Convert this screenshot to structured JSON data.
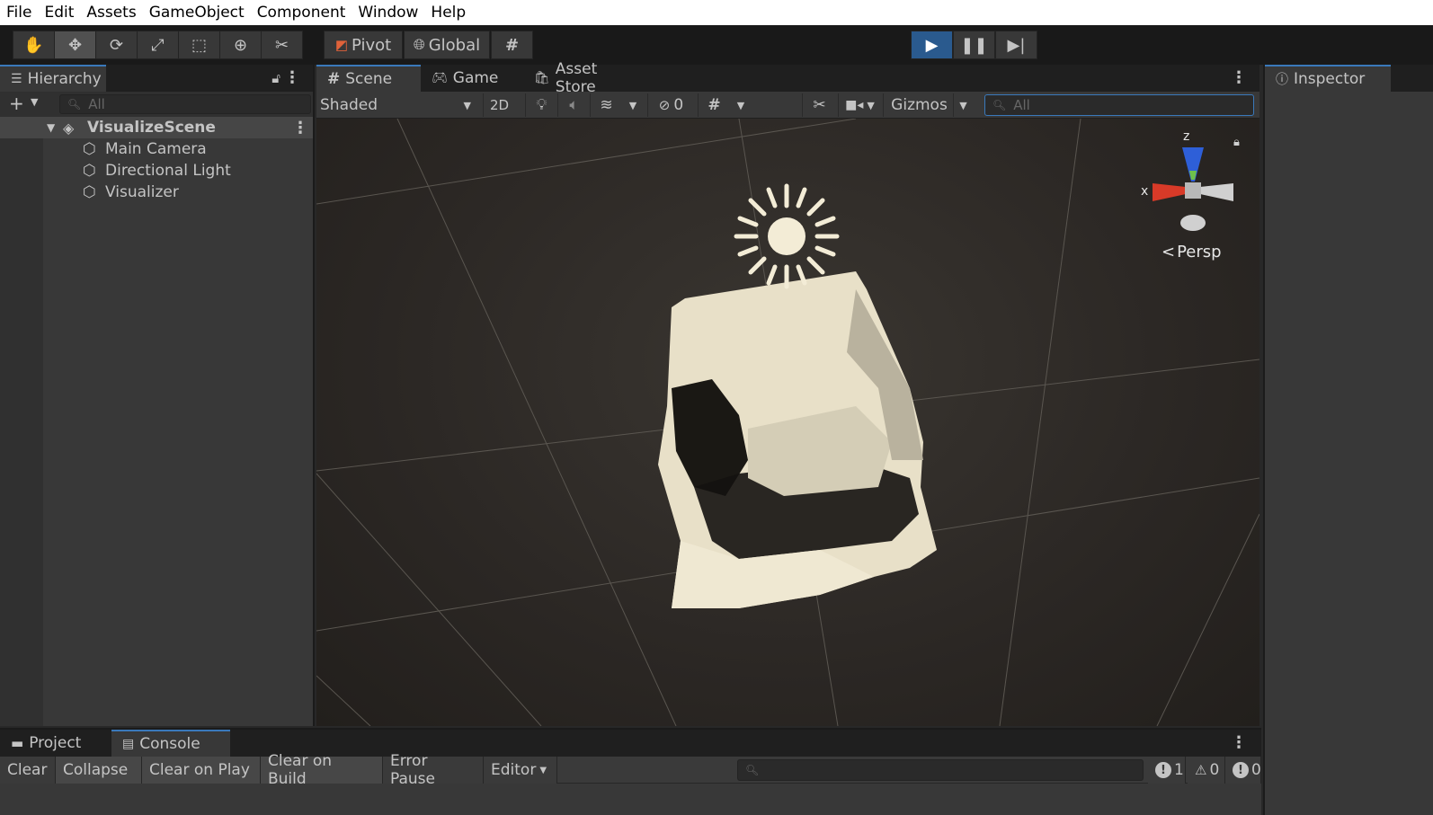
{
  "menu": [
    "File",
    "Edit",
    "Assets",
    "GameObject",
    "Component",
    "Window",
    "Help"
  ],
  "toolbar": {
    "pivot": "Pivot",
    "global": "Global"
  },
  "hierarchy": {
    "tab": "Hierarchy",
    "search_placeholder": "All",
    "scene_name": "VisualizeScene",
    "items": [
      "Main Camera",
      "Directional Light",
      "Visualizer"
    ]
  },
  "scene": {
    "tabs": [
      "Scene",
      "Game",
      "Asset Store"
    ],
    "shading": "Shaded",
    "mode_2d": "2D",
    "hidden_count": "0",
    "gizmos": "Gizmos",
    "search_placeholder": "All",
    "gizmo_axis_z": "z",
    "gizmo_axis_x": "x",
    "projection": "Persp"
  },
  "inspector": {
    "tab": "Inspector"
  },
  "bottom": {
    "tabs": [
      "Project",
      "Console"
    ],
    "buttons": [
      "Clear",
      "Collapse",
      "Clear on Play",
      "Clear on Build",
      "Error Pause",
      "Editor"
    ],
    "log_count": "1",
    "warning_count": "0",
    "error_count": "0"
  },
  "colors": {
    "play_active": "#2a5a8e",
    "tab_accent": "#3a79bb",
    "panel_bg": "#383838"
  }
}
